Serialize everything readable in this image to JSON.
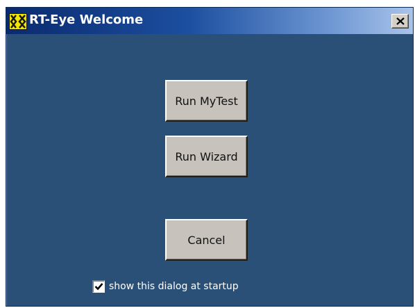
{
  "window": {
    "title": "RT-Eye Welcome",
    "icon": "rt-eye-app-icon",
    "close_icon": "close-x-icon"
  },
  "buttons": {
    "run_mytest": "Run MyTest",
    "run_wizard": "Run Wizard",
    "cancel": "Cancel"
  },
  "startup": {
    "checked": true,
    "label": "show this dialog at startup"
  },
  "colors": {
    "dialog_background": "#2a5078",
    "titlebar_start": "#0a2a6e",
    "titlebar_end": "#a9c4ea",
    "button_face": "#c7c3bc",
    "icon_accent": "#f2e600"
  }
}
